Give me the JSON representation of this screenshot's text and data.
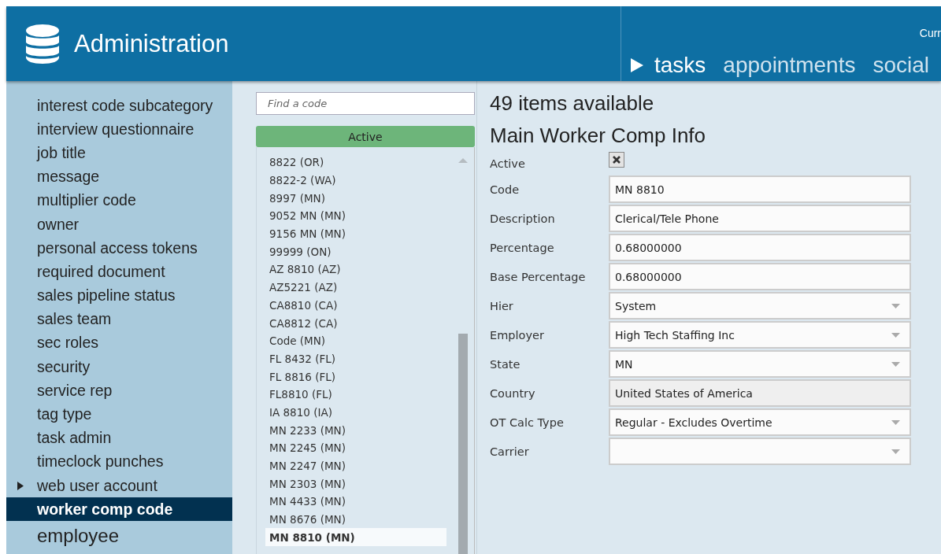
{
  "header": {
    "title": "Administration",
    "top_right": "Curr",
    "nav": [
      {
        "label": "tasks",
        "selected": true
      },
      {
        "label": "appointments",
        "selected": false
      },
      {
        "label": "social",
        "selected": false
      }
    ]
  },
  "sidebar": {
    "items": [
      {
        "label": "interest code subcategory",
        "selected": false,
        "has_children": false
      },
      {
        "label": "interview questionnaire",
        "selected": false,
        "has_children": false
      },
      {
        "label": "job title",
        "selected": false,
        "has_children": false
      },
      {
        "label": "message",
        "selected": false,
        "has_children": false
      },
      {
        "label": "multiplier code",
        "selected": false,
        "has_children": false
      },
      {
        "label": "owner",
        "selected": false,
        "has_children": false
      },
      {
        "label": "personal access tokens",
        "selected": false,
        "has_children": false
      },
      {
        "label": "required document",
        "selected": false,
        "has_children": false
      },
      {
        "label": "sales pipeline status",
        "selected": false,
        "has_children": false
      },
      {
        "label": "sales team",
        "selected": false,
        "has_children": false
      },
      {
        "label": "sec roles",
        "selected": false,
        "has_children": false
      },
      {
        "label": "security",
        "selected": false,
        "has_children": false
      },
      {
        "label": "service rep",
        "selected": false,
        "has_children": false
      },
      {
        "label": "tag type",
        "selected": false,
        "has_children": false
      },
      {
        "label": "task admin",
        "selected": false,
        "has_children": false
      },
      {
        "label": "timeclock punches",
        "selected": false,
        "has_children": false
      },
      {
        "label": "web user account",
        "selected": false,
        "has_children": true
      },
      {
        "label": "worker comp code",
        "selected": true,
        "has_children": false
      }
    ],
    "section": "employee"
  },
  "code_list": {
    "search": {
      "placeholder": "Find a code"
    },
    "filter": "Active",
    "items": [
      {
        "label": "8822 (OR)",
        "selected": false
      },
      {
        "label": "8822-2 (WA)",
        "selected": false
      },
      {
        "label": "8997 (MN)",
        "selected": false
      },
      {
        "label": "9052 MN (MN)",
        "selected": false
      },
      {
        "label": "9156 MN (MN)",
        "selected": false
      },
      {
        "label": "99999 (ON)",
        "selected": false
      },
      {
        "label": "AZ 8810 (AZ)",
        "selected": false
      },
      {
        "label": "AZ5221 (AZ)",
        "selected": false
      },
      {
        "label": "CA8810 (CA)",
        "selected": false
      },
      {
        "label": "CA8812 (CA)",
        "selected": false
      },
      {
        "label": "Code (MN)",
        "selected": false
      },
      {
        "label": "FL 8432 (FL)",
        "selected": false
      },
      {
        "label": "FL 8816 (FL)",
        "selected": false
      },
      {
        "label": "FL8810 (FL)",
        "selected": false
      },
      {
        "label": "IA 8810 (IA)",
        "selected": false
      },
      {
        "label": "MN 2233 (MN)",
        "selected": false
      },
      {
        "label": "MN 2245 (MN)",
        "selected": false
      },
      {
        "label": "MN 2247 (MN)",
        "selected": false
      },
      {
        "label": "MN 2303 (MN)",
        "selected": false
      },
      {
        "label": "MN 4433 (MN)",
        "selected": false
      },
      {
        "label": "MN 8676 (MN)",
        "selected": false
      },
      {
        "label": "MN 8810 (MN)",
        "selected": true
      }
    ]
  },
  "detail": {
    "count": "49 items available",
    "title": "Main Worker Comp Info",
    "fields": [
      {
        "label": "Active",
        "kind": "checkbox",
        "checked": true
      },
      {
        "label": "Code",
        "kind": "text",
        "value": "MN 8810"
      },
      {
        "label": "Description",
        "kind": "text",
        "value": "Clerical/Tele Phone"
      },
      {
        "label": "Percentage",
        "kind": "text",
        "value": "0.68000000"
      },
      {
        "label": "Base Percentage",
        "kind": "text",
        "value": "0.68000000"
      },
      {
        "label": "Hier",
        "kind": "select",
        "value": "System"
      },
      {
        "label": "Employer",
        "kind": "select",
        "value": "High Tech Staffing Inc"
      },
      {
        "label": "State",
        "kind": "select",
        "value": "MN"
      },
      {
        "label": "Country",
        "kind": "readonly",
        "value": "United States of America"
      },
      {
        "label": "OT Calc Type",
        "kind": "select",
        "value": "Regular - Excludes Overtime"
      },
      {
        "label": "Carrier",
        "kind": "select"
      }
    ]
  }
}
